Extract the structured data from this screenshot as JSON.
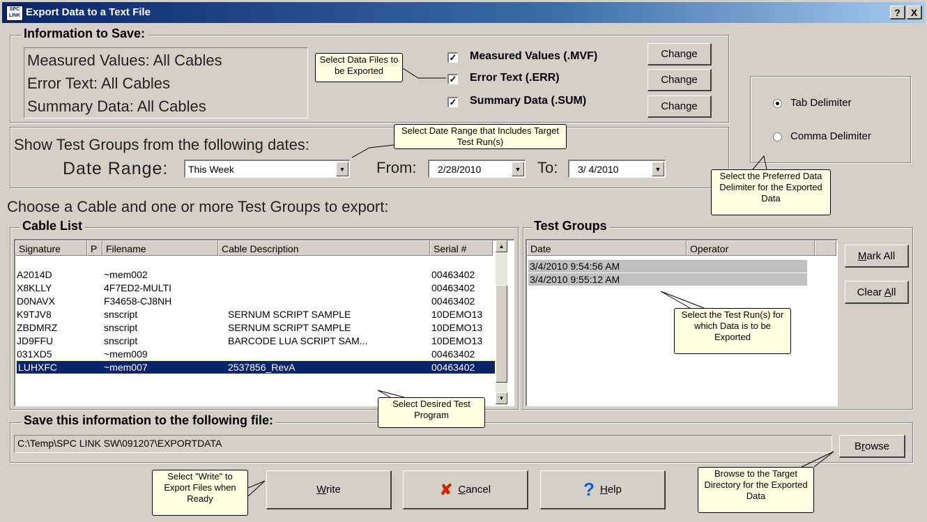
{
  "window": {
    "title": "Export Data to a Text File",
    "icon_text": "SPC LINK",
    "help_btn": "?",
    "close_btn": "X"
  },
  "info": {
    "legend": "Information to Save:",
    "lines": [
      "Measured Values: All Cables",
      "Error Text: All Cables",
      "Summary Data: All Cables"
    ],
    "checks": [
      {
        "label": "Measured Values (.MVF)",
        "checked": true
      },
      {
        "label": "Error Text (.ERR)",
        "checked": true
      },
      {
        "label": "Summary Data (.SUM)",
        "checked": true
      }
    ],
    "change_label": "Change"
  },
  "delimiter": {
    "tab_label": "Tab Delimiter",
    "comma_label": "Comma Delimiter",
    "selected": "tab"
  },
  "dates": {
    "heading": "Show Test Groups from the following dates:",
    "range_label": "Date Range:",
    "range_value": "This Week",
    "from_label": "From:",
    "from_value": "2/28/2010",
    "to_label": "To:",
    "to_value": "3/ 4/2010"
  },
  "choose_text": "Choose a Cable and one or more Test Groups to export:",
  "cable_list": {
    "legend": "Cable List",
    "columns": [
      "Signature",
      "P",
      "Filename",
      "Cable Description",
      "Serial #"
    ],
    "rows": [
      [
        "A2014D",
        "",
        "~mem002",
        "",
        "00463402"
      ],
      [
        "X8KLLY",
        "",
        "4F7ED2-MULTI",
        "",
        "00463402"
      ],
      [
        "D0NAVX",
        "",
        "F34658-CJ8NH",
        "",
        "00463402"
      ],
      [
        "K9TJV8",
        "",
        "snscript",
        "SERNUM SCRIPT SAMPLE",
        "10DEMO13"
      ],
      [
        "ZBDMRZ",
        "",
        "snscript",
        "SERNUM SCRIPT SAMPLE",
        "10DEMO13"
      ],
      [
        "JD9FFU",
        "",
        "snscript",
        "BARCODE LUA SCRIPT SAM...",
        "10DEMO13"
      ],
      [
        "031XD5",
        "",
        "~mem009",
        "",
        "00463402"
      ],
      [
        "LUHXFC",
        "",
        "~mem007",
        "2537856_RevA",
        "00463402"
      ]
    ],
    "selected_index": 7
  },
  "test_groups": {
    "legend": "Test Groups",
    "columns": [
      "Date",
      "Operator"
    ],
    "rows": [
      "3/4/2010 9:54:56 AM",
      "3/4/2010 9:55:12 AM"
    ],
    "mark_all": "Mark All",
    "clear_all": "Clear All"
  },
  "save": {
    "legend": "Save this information to the following file:",
    "path": "C:\\Temp\\SPC LINK SW\\091207\\EXPORTDATA",
    "browse": "Browse"
  },
  "buttons": {
    "write": "Write",
    "cancel": "Cancel",
    "help": "Help"
  },
  "callouts": {
    "select_files": "Select Data Files to be Exported",
    "date_range": "Select Date Range that Includes Target Test Run(s)",
    "delimiter": "Select the Preferred Data Delimiter for the Exported Data",
    "test_run": "Select the Test Run(s) for which Data is to be Exported",
    "test_program": "Select Desired Test Program",
    "write": "Select \"Write\" to Export Files when Ready",
    "browse": "Browse to the Target Directory for the Exported Data"
  },
  "colors": {
    "title_start": "#0a246a",
    "title_end": "#a6caf0",
    "selection": "#0a246a",
    "callout_bg": "#ffffe1",
    "cancel_x": "#cc2200",
    "help_q": "#1a5fd0"
  }
}
